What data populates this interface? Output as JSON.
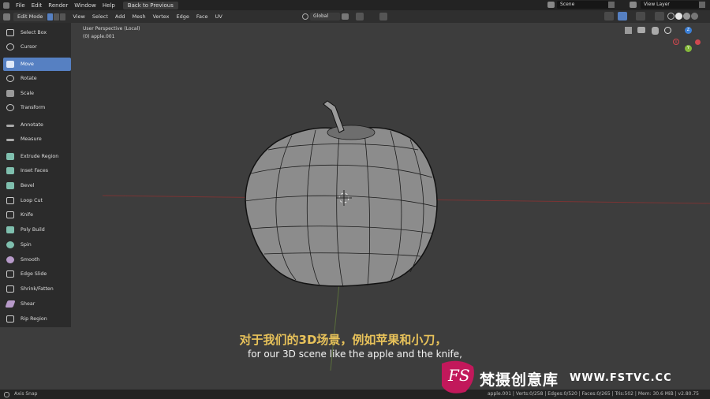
{
  "menu": {
    "file": "File",
    "edit": "Edit",
    "render": "Render",
    "window": "Window",
    "help": "Help",
    "back_to_previous": "Back to Previous"
  },
  "scene_name": "Scene",
  "view_layer": "View Layer",
  "header": {
    "mode": "Edit Mode",
    "view": "View",
    "select": "Select",
    "add": "Add",
    "mesh": "Mesh",
    "vertex": "Vertex",
    "edge": "Edge",
    "face": "Face",
    "uv": "UV",
    "transform_orientation": "Global"
  },
  "viewport": {
    "perspective": "User Perspective (Local)",
    "object": "(0) apple.001"
  },
  "tools": [
    {
      "label": "Select Box",
      "icon": "select-box-icon"
    },
    {
      "label": "Cursor",
      "icon": "cursor-icon"
    },
    {
      "label": "Move",
      "icon": "move-icon"
    },
    {
      "label": "Rotate",
      "icon": "rotate-icon"
    },
    {
      "label": "Scale",
      "icon": "scale-icon"
    },
    {
      "label": "Transform",
      "icon": "transform-icon"
    },
    {
      "label": "Annotate",
      "icon": "annotate-icon"
    },
    {
      "label": "Measure",
      "icon": "measure-icon"
    },
    {
      "label": "Extrude Region",
      "icon": "extrude-icon"
    },
    {
      "label": "Inset Faces",
      "icon": "inset-icon"
    },
    {
      "label": "Bevel",
      "icon": "bevel-icon"
    },
    {
      "label": "Loop Cut",
      "icon": "loop-cut-icon"
    },
    {
      "label": "Knife",
      "icon": "knife-icon"
    },
    {
      "label": "Poly Build",
      "icon": "poly-build-icon"
    },
    {
      "label": "Spin",
      "icon": "spin-icon"
    },
    {
      "label": "Smooth",
      "icon": "smooth-icon"
    },
    {
      "label": "Edge Slide",
      "icon": "edge-slide-icon"
    },
    {
      "label": "Shrink/Fatten",
      "icon": "shrink-fatten-icon"
    },
    {
      "label": "Shear",
      "icon": "shear-icon"
    },
    {
      "label": "Rip Region",
      "icon": "rip-region-icon"
    }
  ],
  "active_tool": "Move",
  "gizmo": {
    "x": "X",
    "y": "Y",
    "z": "Z"
  },
  "subtitle": {
    "cn": "对于我们的3D场景，例如苹果和小刀，",
    "en": "for our 3D scene like the apple and the knife,"
  },
  "status": {
    "left": "Axis Snap",
    "right": "apple.001 | Verts:0/258 | Edges:0/520 | Faces:0/265 | Tris:502 | Mem: 30.6 MiB | v2.80.75"
  },
  "watermark": {
    "logo": "FS",
    "cn": "梵摄创意库",
    "url": "WWW.FSTVC.CC"
  },
  "colors": {
    "accent": "#5680c2",
    "subtitle_cn": "#e8c25a",
    "x_axis": "#d0484f",
    "y_axis": "#84b83a",
    "z_axis": "#3b7fd6"
  }
}
